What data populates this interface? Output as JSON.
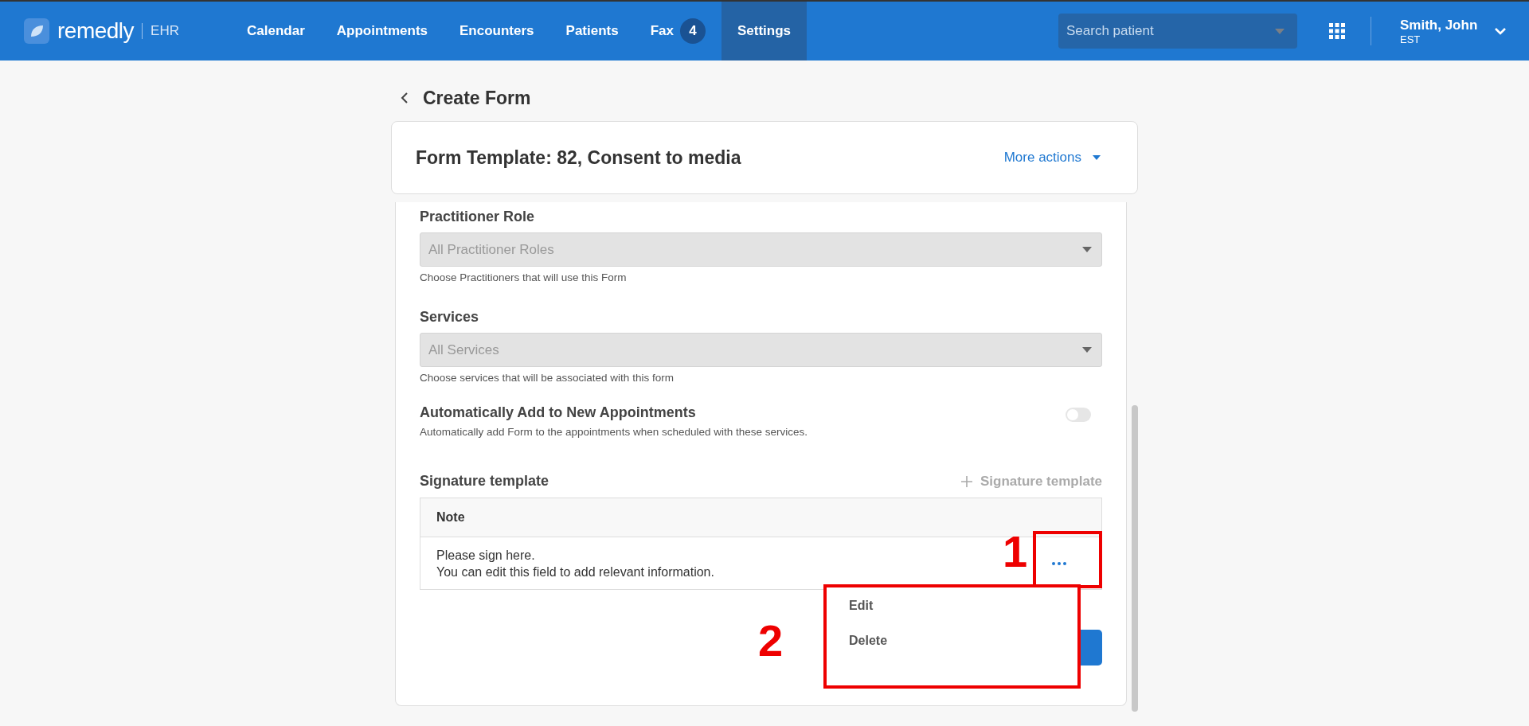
{
  "header": {
    "logo": "remedly",
    "product": "EHR",
    "nav": [
      {
        "label": "Calendar",
        "selected": false
      },
      {
        "label": "Appointments",
        "selected": false
      },
      {
        "label": "Encounters",
        "selected": false
      },
      {
        "label": "Patients",
        "selected": false
      },
      {
        "label": "Fax",
        "badge": "4",
        "selected": false
      },
      {
        "label": "Settings",
        "selected": true
      }
    ],
    "search": {
      "placeholder": "Search patient"
    },
    "user": {
      "name": "Smith, John",
      "timezone": "EST"
    }
  },
  "page": {
    "title": "Create Form"
  },
  "form_card": {
    "title": "Form Template: 82, Consent to media",
    "more_actions": "More actions"
  },
  "fields": [
    {
      "label": "Practitioner Role",
      "placeholder": "All Practitioner Roles",
      "hint": "Choose Practitioners that will use this Form"
    },
    {
      "label": "Services",
      "placeholder": "All Services",
      "hint": "Choose services that will be associated with this form"
    }
  ],
  "auto_add": {
    "label": "Automatically Add to New Appointments",
    "description": "Automatically add Form to the appointments when scheduled with these services.",
    "on": false
  },
  "signature": {
    "title": "Signature template",
    "add_button": "Signature template",
    "table": {
      "columns": [
        "Note"
      ],
      "rows": [
        {
          "note_lines": [
            "Please sign here.",
            "You can edit this field to add relevant information."
          ]
        }
      ]
    }
  },
  "row_menu": {
    "items": [
      "Edit",
      "Delete"
    ]
  },
  "annotations": [
    {
      "label": "1"
    },
    {
      "label": "2"
    }
  ]
}
